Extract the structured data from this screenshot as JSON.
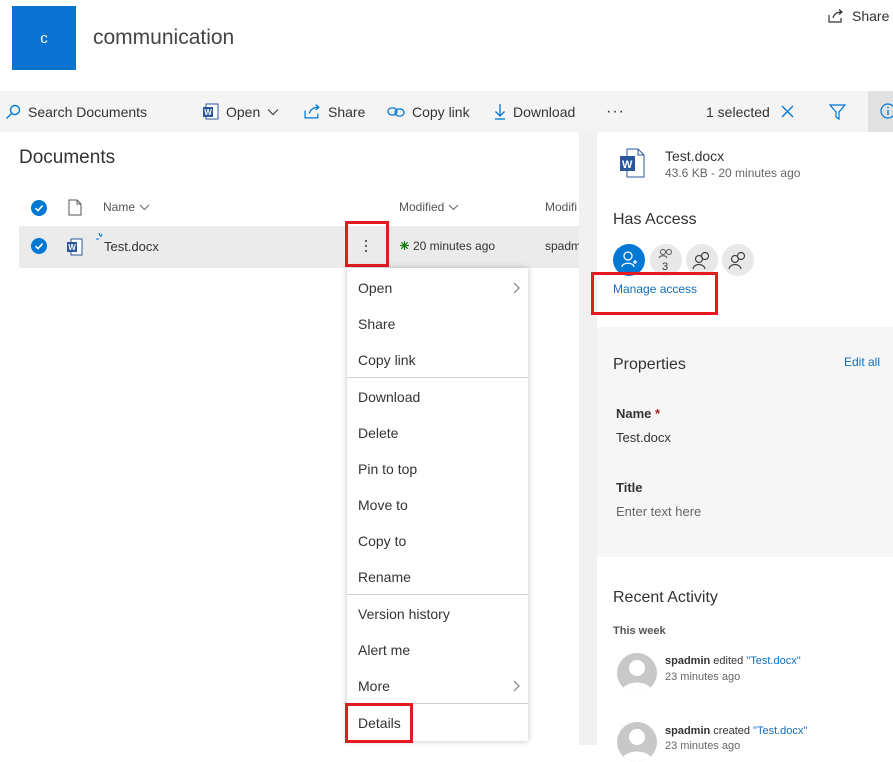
{
  "site": {
    "logo_letter": "c",
    "title": "communication",
    "share_label": "Share",
    "brand_color": "#0a73d1"
  },
  "commandbar": {
    "search_placeholder": "Search Documents",
    "open_label": "Open",
    "share_label": "Share",
    "copy_link_label": "Copy link",
    "download_label": "Download",
    "more_label": "···",
    "selected_label": "1 selected"
  },
  "list": {
    "title": "Documents",
    "columns": {
      "name": "Name",
      "modified": "Modified",
      "modified_by": "Modifi"
    },
    "rows": [
      {
        "name": "Test.docx",
        "modified": "20 minutes ago",
        "modified_by": "spadm"
      }
    ]
  },
  "context_menu": {
    "items": [
      {
        "label": "Open"
      },
      {
        "label": "Share"
      },
      {
        "label": "Copy link"
      },
      {
        "label": "Download"
      },
      {
        "label": "Delete"
      },
      {
        "label": "Pin to top"
      },
      {
        "label": "Move to"
      },
      {
        "label": "Copy to"
      },
      {
        "label": "Rename"
      },
      {
        "label": "Version history"
      },
      {
        "label": "Alert me"
      },
      {
        "label": "More"
      },
      {
        "label": "Details"
      }
    ]
  },
  "details": {
    "file_name": "Test.docx",
    "file_meta": "43.6 KB - 20 minutes ago",
    "has_access_title": "Has Access",
    "access_count": "3",
    "manage_access_label": "Manage access",
    "properties_title": "Properties",
    "edit_all_label": "Edit all",
    "name_label": "Name",
    "required_mark": "*",
    "name_value": "Test.docx",
    "title_label": "Title",
    "title_placeholder": "Enter text here",
    "recent_activity_title": "Recent Activity",
    "this_week_label": "This week",
    "activities": [
      {
        "user": "spadmin",
        "action": " edited ",
        "file": "\"Test.docx\"",
        "time": "23 minutes ago"
      },
      {
        "user": "spadmin",
        "action": " created ",
        "file": "\"Test.docx\"",
        "time": "23 minutes ago"
      }
    ]
  },
  "colors": {
    "accent": "#0078d4",
    "highlight": "#e31c23",
    "link": "#106ebe",
    "word_blue": "#2b579a"
  }
}
